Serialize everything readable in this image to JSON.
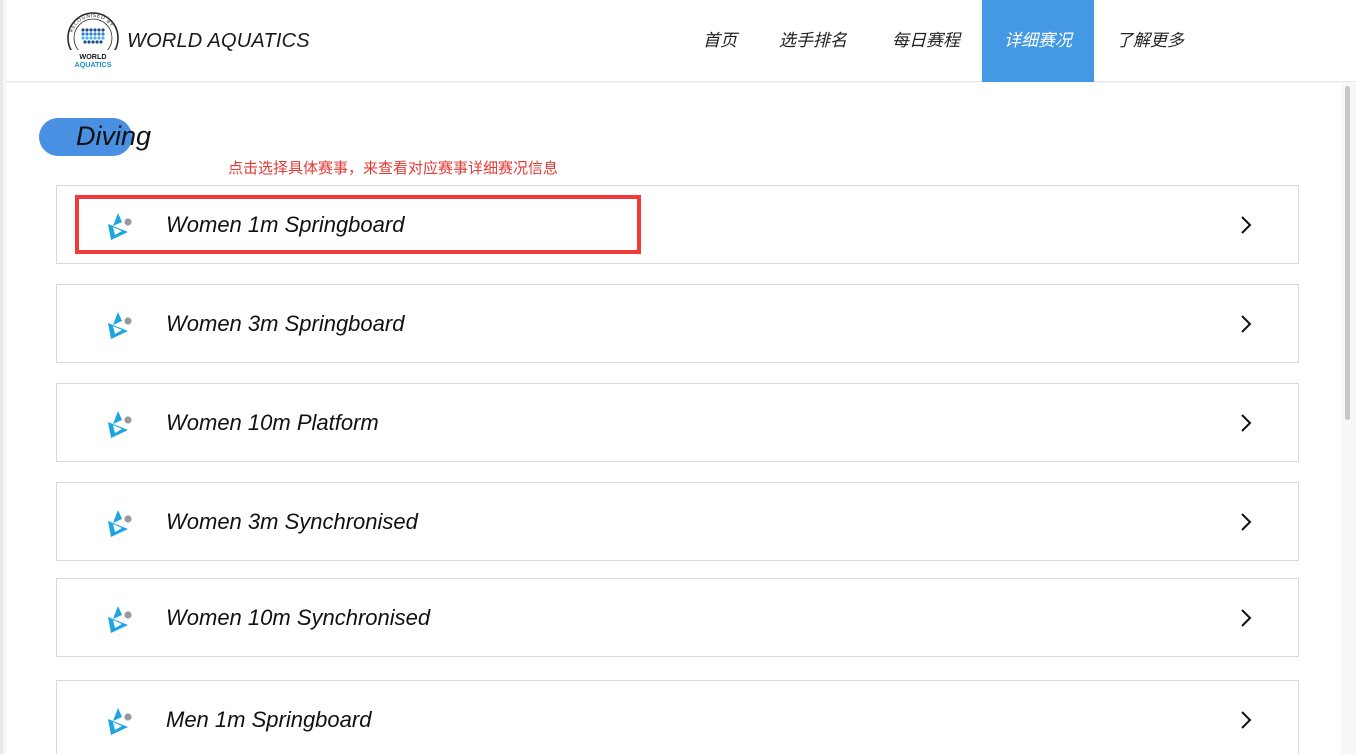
{
  "header": {
    "brand": "WORLD AQUATICS",
    "logo": {
      "ring_text": "RECOGNISED BY",
      "line1": "WORLD",
      "line2": "AQUATICS"
    },
    "nav": [
      {
        "label": "首页",
        "active": false
      },
      {
        "label": "选手排名",
        "active": false
      },
      {
        "label": "每日赛程",
        "active": false
      },
      {
        "label": "详细赛况",
        "active": true
      },
      {
        "label": "了解更多",
        "active": false
      }
    ]
  },
  "section": {
    "title": "Diving",
    "hint": "点击选择具体赛事，来查看对应赛事详细赛况信息"
  },
  "events": [
    {
      "label": "Women 1m Springboard",
      "icon": "diving-icon"
    },
    {
      "label": "Women 3m Springboard",
      "icon": "diving-icon"
    },
    {
      "label": "Women 10m Platform",
      "icon": "diving-icon"
    },
    {
      "label": "Women 3m Synchronised",
      "icon": "diving-icon"
    },
    {
      "label": "Women 10m Synchronised",
      "icon": "diving-icon"
    },
    {
      "label": "Men 1m Springboard",
      "icon": "diving-icon"
    }
  ],
  "colors": {
    "accent": "#4499e4",
    "pill": "#4a90e2",
    "hint": "#e53935",
    "highlight": "#ef3b3b",
    "icon_cyan": "#1ba6e0",
    "icon_grey": "#9a9a9a"
  }
}
